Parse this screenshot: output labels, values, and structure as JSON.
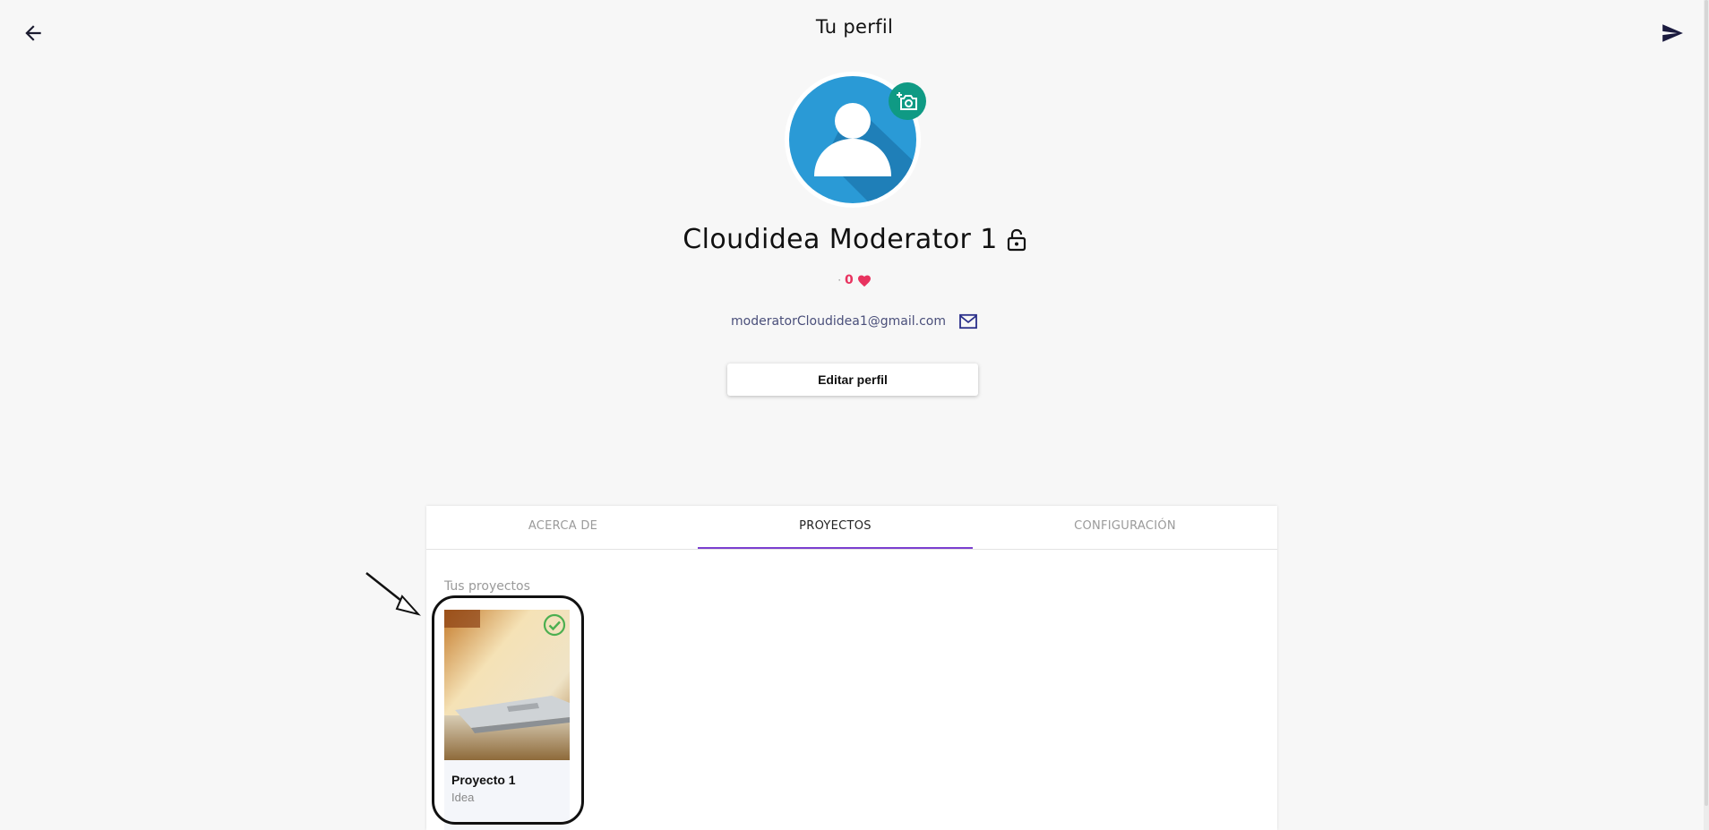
{
  "header": {
    "title": "Tu perfil",
    "back_icon": "arrow-left-icon",
    "send_icon": "send-icon"
  },
  "profile": {
    "avatar_icon": "user-avatar-icon",
    "camera_icon": "add-photo-icon",
    "name": "Cloudidea Moderator 1",
    "lock_icon": "lock-open-icon",
    "likes_separator": "·",
    "likes": "0",
    "likes_icon": "heart-icon",
    "email": "moderatorCloudidea1@gmail.com",
    "email_icon": "mail-icon",
    "edit_button": "Editar perfil"
  },
  "tabs": [
    {
      "label": "ACERCA DE",
      "active": false
    },
    {
      "label": "PROYECTOS",
      "active": true
    },
    {
      "label": "CONFIGURACIÓN",
      "active": false
    }
  ],
  "projects_section": {
    "label": "Tus proyectos",
    "items": [
      {
        "name": "Proyecto 1",
        "stage": "Idea",
        "status_icon": "check-circle-icon"
      }
    ]
  },
  "colors": {
    "accent": "#7b3fd0",
    "avatar_blue": "#2a9ad6",
    "camera_green": "#0f9a84",
    "heart": "#e8335f",
    "check_green": "#4caf50"
  }
}
